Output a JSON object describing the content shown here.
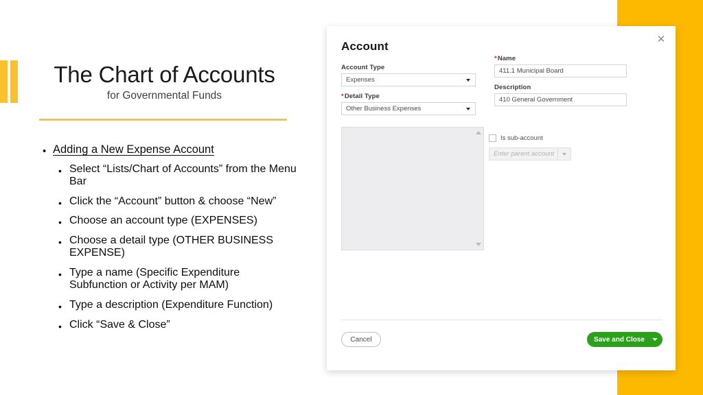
{
  "slide": {
    "title": "The Chart of Accounts",
    "subtitle": "for Governmental Funds",
    "accent_color": "#fcb900",
    "rule_color": "#f2c73c",
    "bullets": [
      {
        "level": 1,
        "marker": "•",
        "text": "Adding a New Expense Account"
      },
      {
        "level": 2,
        "marker": "•",
        "text": "Select “Lists/Chart of Accounts” from the Menu Bar"
      },
      {
        "level": 2,
        "marker": "•",
        "text": "Click the “Account” button & choose “New”"
      },
      {
        "level": 2,
        "marker": "•",
        "text": "Choose an account type (EXPENSES)"
      },
      {
        "level": 2,
        "marker": "•",
        "text": "Choose a detail type (OTHER BUSINESS EXPENSE)"
      },
      {
        "level": 2,
        "marker": "•",
        "text": "Type a name (Specific Expenditure Subfunction or Activity per MAM)"
      },
      {
        "level": 2,
        "marker": "•",
        "text": "Type a description (Expenditure Function)"
      },
      {
        "level": 2,
        "marker": "•",
        "text": "Click “Save & Close”"
      }
    ]
  },
  "dialog": {
    "title": "Account",
    "close_icon": "close-icon",
    "account_type": {
      "label": "Account Type",
      "required": false,
      "value": "Expenses",
      "caret_icon": "chevron-down-icon"
    },
    "detail_type": {
      "label": "Detail Type",
      "required": true,
      "required_marker": "*",
      "value": "Other Business Expenses",
      "caret_icon": "chevron-down-icon"
    },
    "name": {
      "label": "Name",
      "required": true,
      "required_marker": "*",
      "value": "411.1 Municipal Board"
    },
    "description": {
      "label": "Description",
      "required": false,
      "value": "410 General Government"
    },
    "sub_account": {
      "label": "Is sub-account",
      "checked": false,
      "parent_placeholder": "Enter parent account",
      "parent_value": "",
      "disabled": true,
      "caret_icon": "chevron-down-icon"
    },
    "detail_panel": {
      "name": "detail-list-panel",
      "content": "",
      "scroll_up_icon": "scroll-up-arrow-icon",
      "scroll_down_icon": "scroll-down-arrow-icon"
    },
    "footer": {
      "cancel_label": "Cancel",
      "save_label": "Save and Close",
      "save_color": "#2ca01c",
      "save_caret_icon": "chevron-down-icon"
    }
  }
}
